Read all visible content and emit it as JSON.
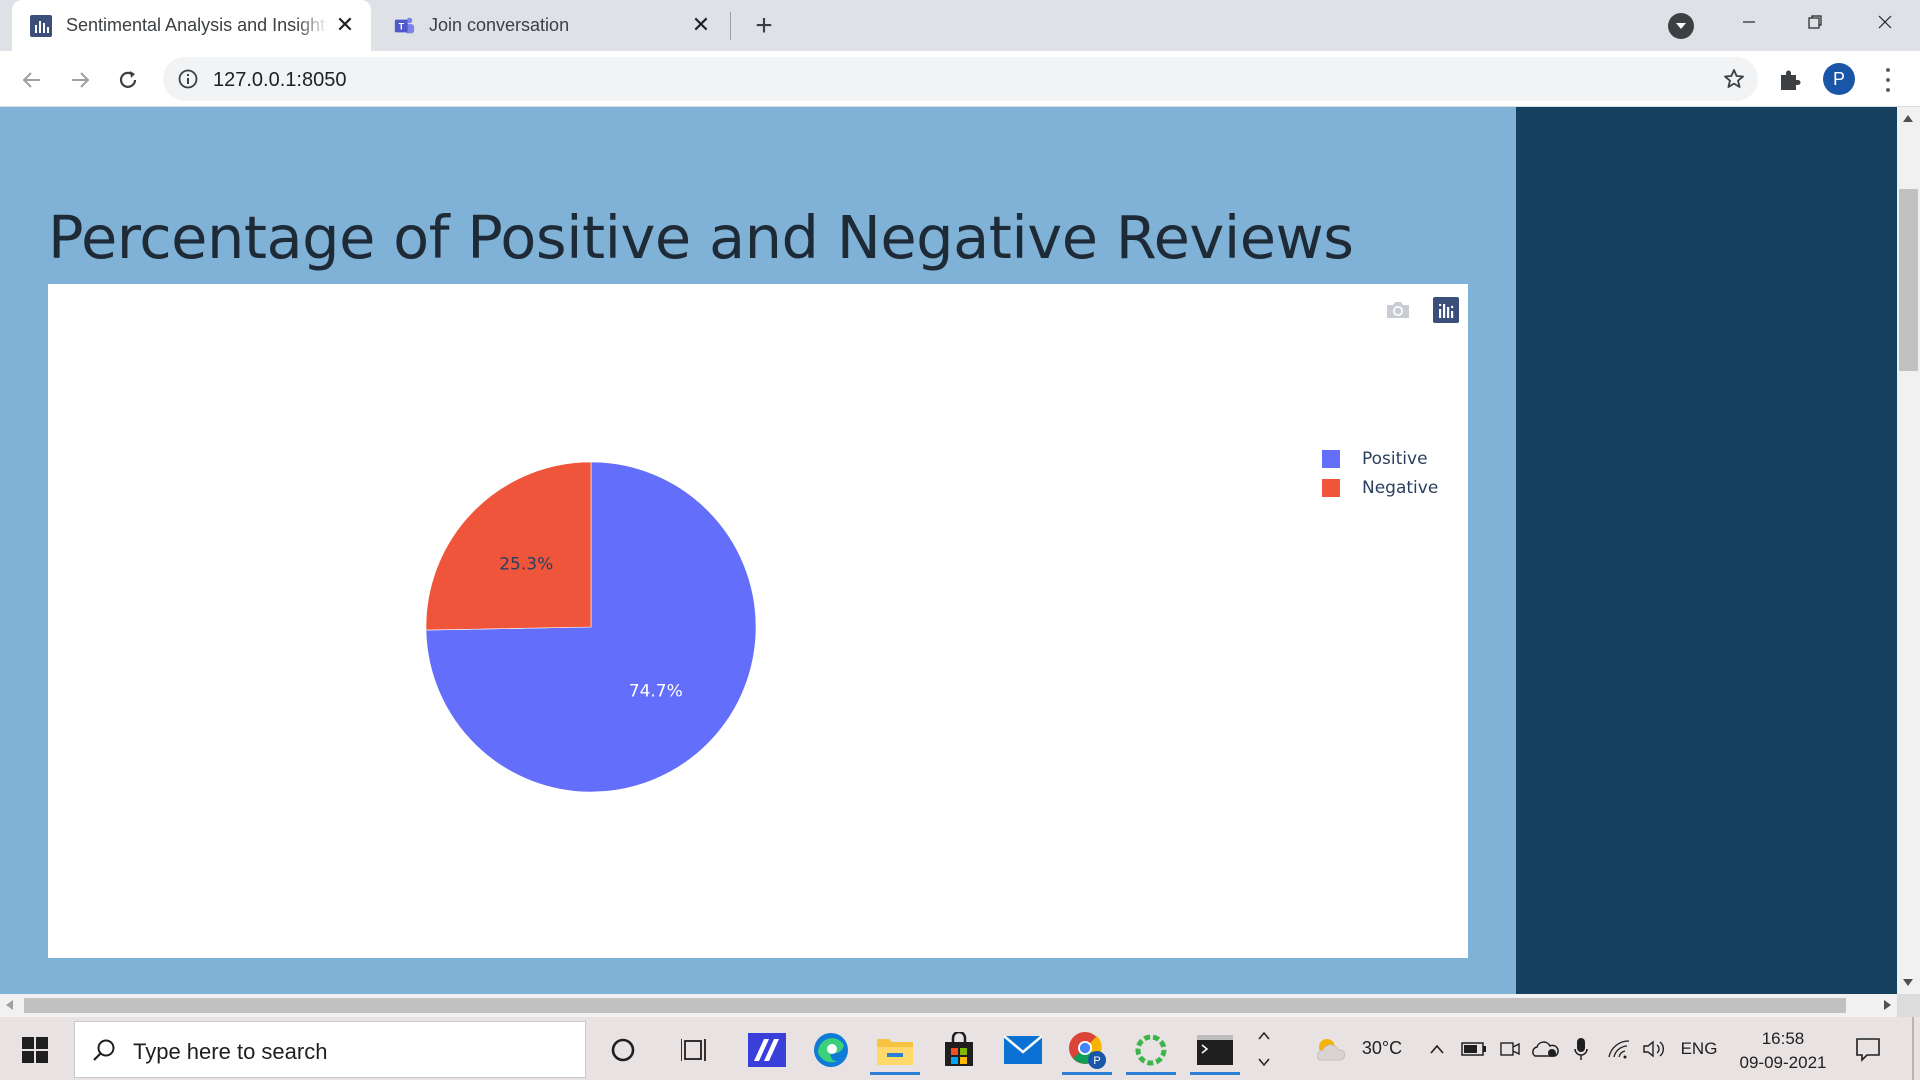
{
  "browser": {
    "tabs": [
      {
        "title": "Sentimental Analysis and Insights",
        "favicon": "dash-bar-chart-icon",
        "active": true
      },
      {
        "title": "Join conversation",
        "favicon": "teams-icon",
        "active": false
      }
    ],
    "url": "127.0.0.1:8050",
    "profile_initial": "P"
  },
  "page": {
    "heading": "Percentage of Positive and Negative Reviews",
    "background_color": "#7fb2d6",
    "side_panel_color": "#16405f"
  },
  "chart_data": {
    "type": "pie",
    "title": "",
    "labels": [
      "Positive",
      "Negative"
    ],
    "values": [
      74.7,
      25.3
    ],
    "percent_labels": [
      "74.7%",
      "25.3%"
    ],
    "colors": [
      "#636efa",
      "#ef553b"
    ],
    "legend_position": "top-right"
  },
  "taskbar": {
    "search_placeholder": "Type here to search",
    "weather_temp": "30°C",
    "language": "ENG",
    "time": "16:58",
    "date": "09-09-2021",
    "icons": [
      "cortana-icon",
      "task-view-icon",
      "vsto-icon",
      "edge-icon",
      "file-explorer-icon",
      "store-icon",
      "mail-icon",
      "chrome-icon",
      "refresh-app-icon",
      "terminal-icon"
    ]
  }
}
